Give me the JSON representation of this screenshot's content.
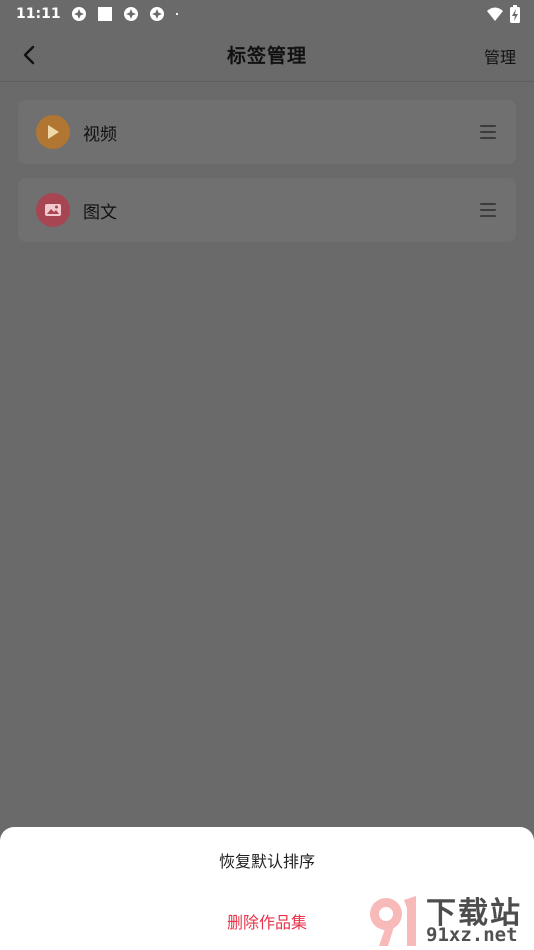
{
  "status_bar": {
    "time": "11:11",
    "icons": [
      "notification-icon",
      "stop-icon",
      "notification-icon",
      "notification-icon",
      "dot-icon"
    ],
    "right_icons": [
      "wifi-icon",
      "battery-charging-icon"
    ]
  },
  "header": {
    "title": "标签管理",
    "manage_label": "管理"
  },
  "tags": [
    {
      "label": "视频",
      "icon": "play-icon",
      "color": "#b07632"
    },
    {
      "label": "图文",
      "icon": "image-icon",
      "color": "#a84552"
    }
  ],
  "sheet": {
    "restore_label": "恢复默认排序",
    "delete_label": "删除作品集"
  },
  "watermark": {
    "brand": "下载站",
    "domain": "91xz.net"
  }
}
